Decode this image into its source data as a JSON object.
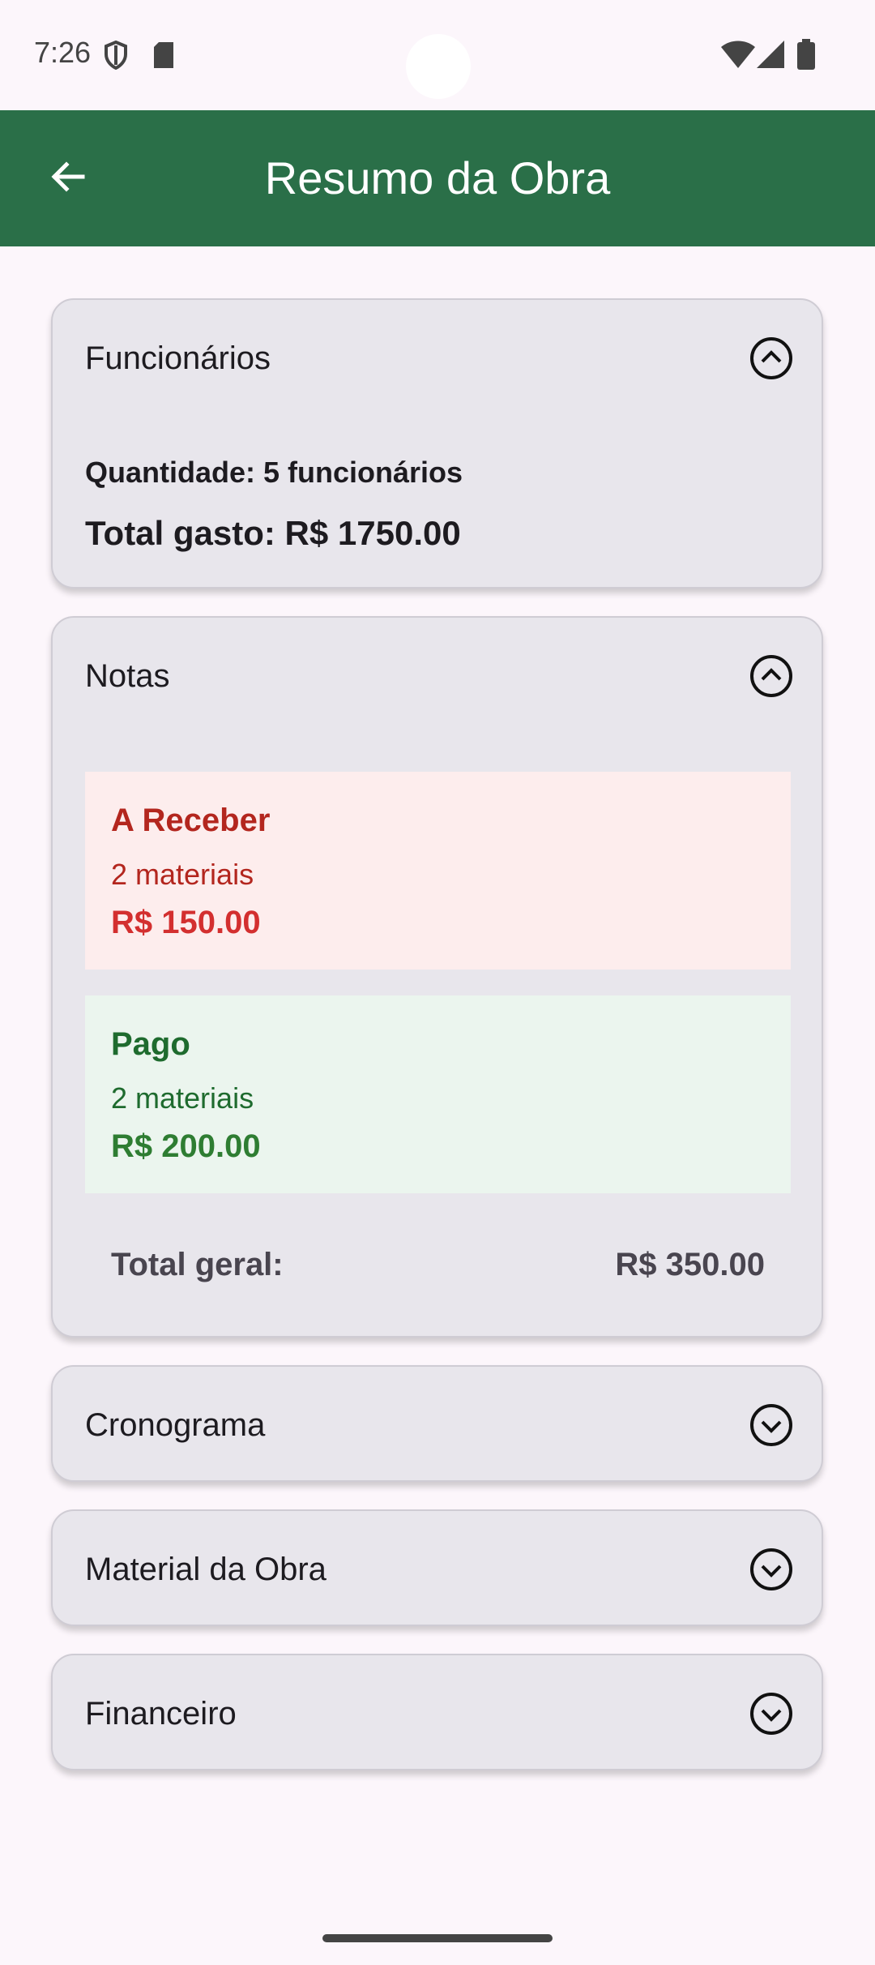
{
  "status_bar": {
    "time": "7:26",
    "icons": [
      "shield-icon",
      "sd-card-icon",
      "wifi-icon",
      "signal-icon",
      "battery-icon"
    ]
  },
  "app_bar": {
    "title": "Resumo da Obra",
    "back_icon": "arrow-left-icon",
    "background_color": "#2a6f48"
  },
  "sections": {
    "funcionarios": {
      "title": "Funcionários",
      "expanded": true,
      "quantidade": "Quantidade: 5 funcionários",
      "total_gasto": "Total gasto: R$ 1750.00"
    },
    "notas": {
      "title": "Notas",
      "expanded": true,
      "a_receber": {
        "title": "A Receber",
        "count": "2 materiais",
        "value": "R$ 150.00"
      },
      "pago": {
        "title": "Pago",
        "count": "2 materiais",
        "value": "R$ 200.00"
      },
      "total_geral_label": "Total geral:",
      "total_geral_value": "R$ 350.00"
    },
    "cronograma": {
      "title": "Cronograma",
      "expanded": false
    },
    "material": {
      "title": "Material da Obra",
      "expanded": false
    },
    "financeiro": {
      "title": "Financeiro",
      "expanded": false
    }
  },
  "colors": {
    "receber_text": "#b3261e",
    "receber_bg": "#fdeded",
    "pago_text": "#1e6b2e",
    "pago_bg": "#ebf5ee"
  }
}
